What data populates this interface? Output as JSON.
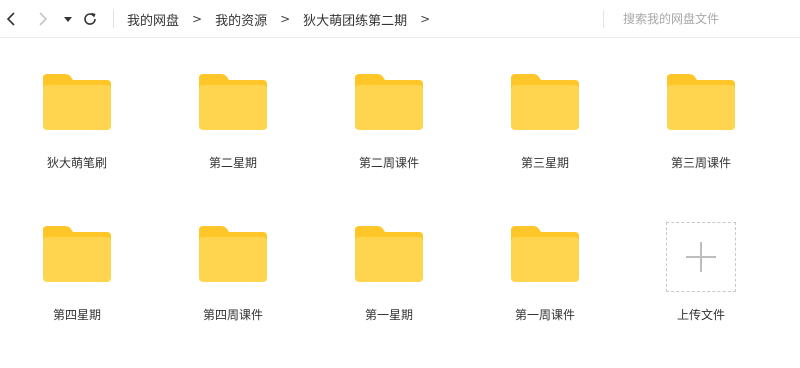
{
  "toolbar": {
    "back_icon": "chevron-left-icon",
    "forward_icon": "chevron-right-icon",
    "history_icon": "caret-down-icon",
    "refresh_icon": "refresh-icon"
  },
  "breadcrumb": {
    "items": [
      "我的网盘",
      "我的资源",
      "狄大萌团练第二期"
    ],
    "separator": ">"
  },
  "search": {
    "placeholder": "搜索我的网盘文件"
  },
  "colors": {
    "folder_body": "#FFD54F",
    "folder_tab": "#FFC62A",
    "upload_plus": "#bdbdbd"
  },
  "folders": [
    {
      "name": "狄大萌笔刷"
    },
    {
      "name": "第二星期"
    },
    {
      "name": "第二周课件"
    },
    {
      "name": "第三星期"
    },
    {
      "name": "第三周课件"
    },
    {
      "name": "第四星期"
    },
    {
      "name": "第四周课件"
    },
    {
      "name": "第一星期"
    },
    {
      "name": "第一周课件"
    }
  ],
  "upload": {
    "label": "上传文件",
    "icon": "plus-icon"
  }
}
